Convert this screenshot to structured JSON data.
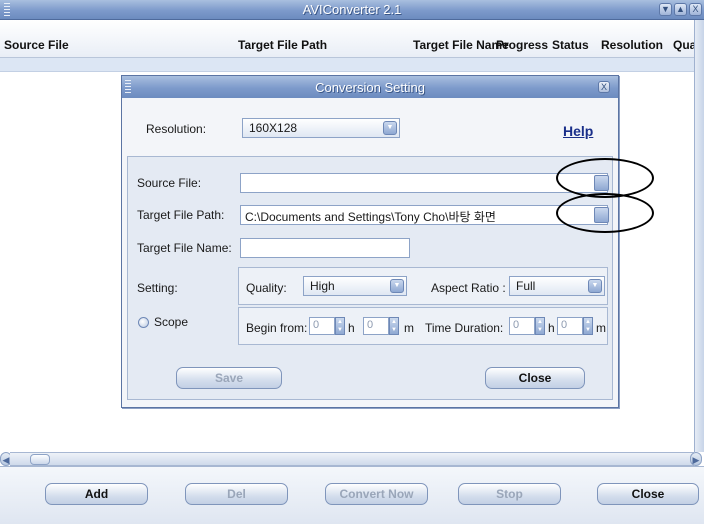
{
  "app": {
    "title": "AVIConverter 2.1",
    "window_buttons": [
      "▼",
      "▲",
      "X"
    ]
  },
  "columns": [
    "Source File",
    "Target File Path",
    "Target File Name",
    "Progress",
    "Status",
    "Resolution",
    "Qua"
  ],
  "bottom_buttons": {
    "add": "Add",
    "del": "Del",
    "convert": "Convert Now",
    "stop": "Stop",
    "close": "Close"
  },
  "dialog": {
    "title": "Conversion Setting",
    "close_glyph": "X",
    "resolution_label": "Resolution:",
    "resolution_value": "160X128",
    "help_label": "Help",
    "source_file_label": "Source File:",
    "source_file_value": "",
    "target_path_label": "Target File Path:",
    "target_path_value": "C:\\Documents and Settings\\Tony Cho\\바탕 화면",
    "target_name_label": "Target File Name:",
    "target_name_value": "",
    "setting_label": "Setting:",
    "quality_label": "Quality:",
    "quality_value": "High",
    "aspect_label": "Aspect Ratio :",
    "aspect_value": "Full",
    "scope_label": "Scope",
    "begin_label": "Begin from:",
    "begin_h": "0",
    "begin_m": "0",
    "h_unit": "h",
    "m_unit": "m",
    "duration_label": "Time Duration:",
    "duration_h": "0",
    "duration_m": "0",
    "save_label": "Save",
    "close_label": "Close"
  }
}
